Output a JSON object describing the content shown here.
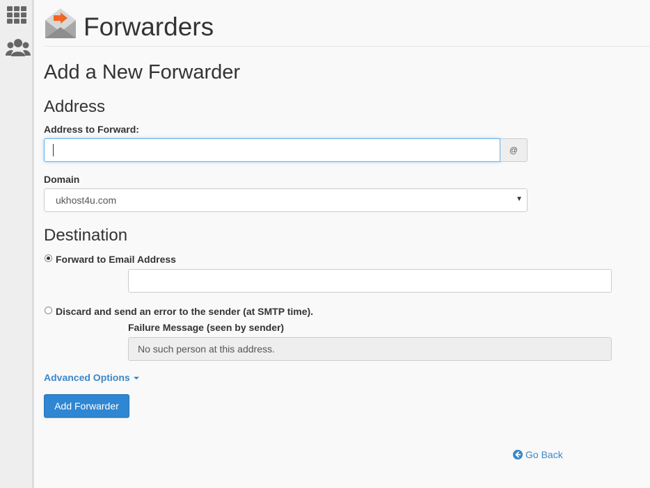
{
  "app": {
    "title": "Forwarders"
  },
  "sidebar": {
    "icons": [
      "grid-icon",
      "users-icon"
    ]
  },
  "page": {
    "title": "Add a New Forwarder"
  },
  "address_section": {
    "heading": "Address",
    "address_label": "Address to Forward:",
    "address_value": "",
    "at_symbol": "@",
    "domain_label": "Domain",
    "domain_selected": "ukhost4u.com"
  },
  "destination_section": {
    "heading": "Destination",
    "forward_option_label": "Forward to Email Address",
    "forward_option_selected": true,
    "forward_value": "",
    "discard_option_label": "Discard and send an error to the sender (at SMTP time).",
    "discard_option_selected": false,
    "failure_label": "Failure Message (seen by sender)",
    "failure_value": "No such person at this address."
  },
  "advanced_options_label": "Advanced Options",
  "submit_label": "Add Forwarder",
  "go_back_label": "Go Back",
  "colors": {
    "accent": "#2f86d2",
    "link": "#3a87c9",
    "logo_orange": "#f26522"
  }
}
